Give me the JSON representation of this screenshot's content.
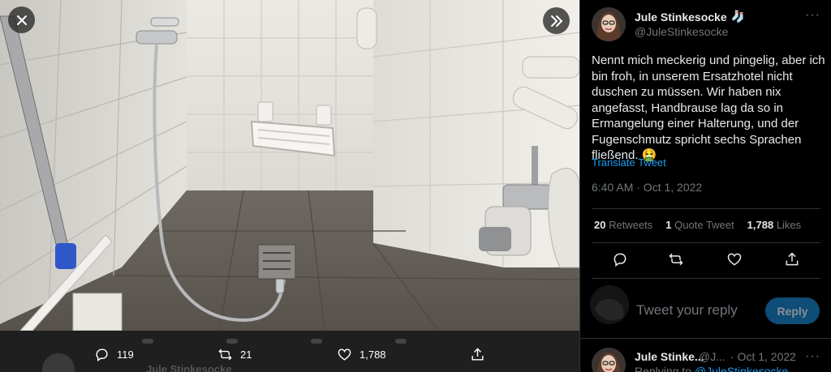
{
  "media": {
    "photo_alt": "Shower room with wall-mounted fold-down seat, hand shower hose on tiled floor, drain and toilet brush holder",
    "actions": [
      {
        "icon": "reply-icon",
        "count": "119"
      },
      {
        "icon": "retweet-icon",
        "count": "21"
      },
      {
        "icon": "like-icon",
        "count": "1,788"
      },
      {
        "icon": "share-icon",
        "count": ""
      }
    ],
    "ghost_name": "Jule Stinkesocke"
  },
  "tweet": {
    "author_name": "Jule Stinkesocke",
    "author_emoji": "🧦",
    "author_handle": "@JuleStinkesocke",
    "text": "Nennt mich meckerig und pingelig, aber ich bin froh, in unserem Ersatzhotel nicht duschen zu müssen. Wir haben nix angefasst, Handbrause lag da so in Ermangelung einer Halterung, und der Fugenschmutz spricht sechs Sprachen fließend. 🤮",
    "translate_label": "Translate Tweet",
    "timestamp": "6:40 AM · Oct 1, 2022",
    "stats": [
      {
        "value": "20",
        "label": "Retweets"
      },
      {
        "value": "1",
        "label": "Quote Tweet"
      },
      {
        "value": "1,788",
        "label": "Likes"
      }
    ],
    "action_icons": [
      "reply-icon",
      "retweet-icon",
      "like-icon",
      "share-icon"
    ]
  },
  "reply_box": {
    "placeholder": "Tweet your reply",
    "button_label": "Reply"
  },
  "reply_tweet": {
    "author_name": "Jule Stinke...",
    "author_handle": "@J...",
    "date": "· Oct 1, 2022",
    "replying_prefix": "Replying to ",
    "replying_handle": "@JuleStinkesocke"
  },
  "colors": {
    "accent": "#1d9bf0",
    "reply_button": "#0e4d77",
    "muted_text": "#71767b",
    "panel_bg": "#000000"
  }
}
